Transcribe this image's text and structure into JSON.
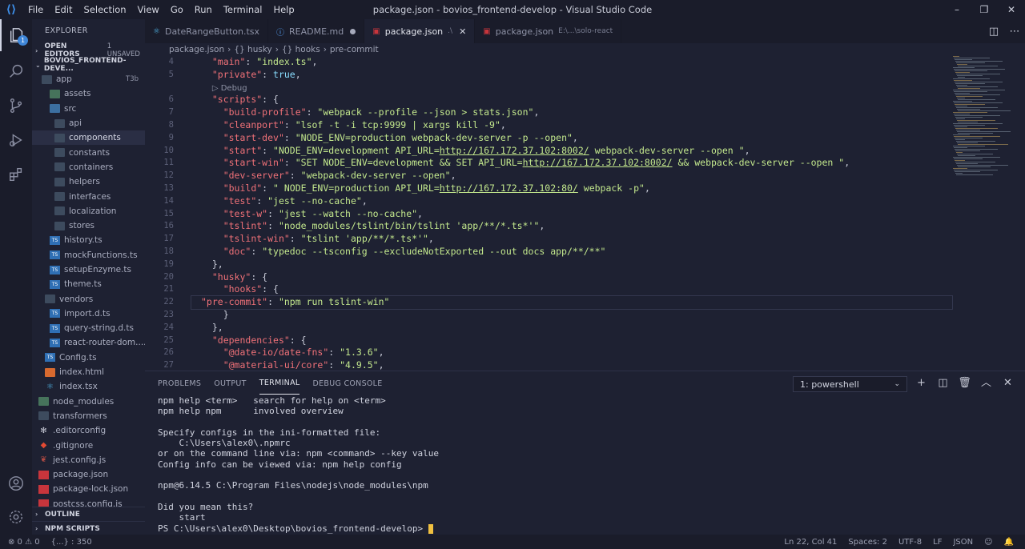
{
  "titlebar": {
    "menu": [
      "File",
      "Edit",
      "Selection",
      "View",
      "Go",
      "Run",
      "Terminal",
      "Help"
    ],
    "window_title": "package.json - bovios_frontend-develop - Visual Studio Code",
    "controls": [
      "–",
      "❐",
      "✕"
    ]
  },
  "activity": {
    "explorer_badge": "1"
  },
  "sidebar": {
    "title": "EXPLORER",
    "open_editors": "OPEN EDITORS",
    "unsaved": "1 UNSAVED",
    "project": "BOVIOS_FRONTEND-DEVE...",
    "tree": [
      {
        "label": "app",
        "icon": "folder",
        "indent": 12,
        "tag": "T3b"
      },
      {
        "label": "assets",
        "icon": "folder green",
        "indent": 22
      },
      {
        "label": "src",
        "icon": "folder blue",
        "indent": 22
      },
      {
        "label": "api",
        "icon": "folder",
        "indent": 28
      },
      {
        "label": "components",
        "icon": "folder",
        "indent": 28,
        "selected": true
      },
      {
        "label": "constants",
        "icon": "folder",
        "indent": 28
      },
      {
        "label": "containers",
        "icon": "folder",
        "indent": 28
      },
      {
        "label": "helpers",
        "icon": "folder",
        "indent": 28
      },
      {
        "label": "interfaces",
        "icon": "folder",
        "indent": 28
      },
      {
        "label": "localization",
        "icon": "folder",
        "indent": 28
      },
      {
        "label": "stores",
        "icon": "folder",
        "indent": 28
      },
      {
        "label": "history.ts",
        "icon": "ts",
        "indent": 22
      },
      {
        "label": "mockFunctions.ts",
        "icon": "ts",
        "indent": 22
      },
      {
        "label": "setupEnzyme.ts",
        "icon": "ts",
        "indent": 22
      },
      {
        "label": "theme.ts",
        "icon": "ts",
        "indent": 22
      },
      {
        "label": "vendors",
        "icon": "folder",
        "indent": 16
      },
      {
        "label": "import.d.ts",
        "icon": "ts",
        "indent": 22
      },
      {
        "label": "query-string.d.ts",
        "icon": "ts",
        "indent": 22
      },
      {
        "label": "react-router-dom....",
        "icon": "ts",
        "indent": 22
      },
      {
        "label": "Config.ts",
        "icon": "ts",
        "indent": 16
      },
      {
        "label": "index.html",
        "icon": "html",
        "indent": 16
      },
      {
        "label": "index.tsx",
        "icon": "tsx",
        "indent": 16
      },
      {
        "label": "node_modules",
        "icon": "folder green",
        "indent": 8
      },
      {
        "label": "transformers",
        "icon": "folder",
        "indent": 8
      },
      {
        "label": ".editorconfig",
        "icon": "cfg",
        "indent": 8
      },
      {
        "label": ".gitignore",
        "icon": "git",
        "indent": 8
      },
      {
        "label": "jest.config.js",
        "icon": "jest",
        "indent": 8
      },
      {
        "label": "package.json",
        "icon": "json",
        "indent": 8
      },
      {
        "label": "package-lock.json",
        "icon": "json",
        "indent": 8
      },
      {
        "label": "postcss.config.js",
        "icon": "json",
        "indent": 8
      }
    ],
    "outline": "OUTLINE",
    "npm_scripts": "NPM SCRIPTS"
  },
  "tabs": [
    {
      "label": "DateRangeButton.tsx",
      "icon": "⚛",
      "color": "#4fb0e0"
    },
    {
      "label": "README.md",
      "icon": "ⓘ",
      "color": "#58a6ff",
      "dot": true
    },
    {
      "label": "package.json",
      "icon": "▣",
      "color": "#c8353c",
      "sub": ".\\",
      "active": true,
      "close": "✕"
    },
    {
      "label": "package.json",
      "icon": "▣",
      "color": "#c8353c",
      "sub": "E:\\...\\solo-react"
    }
  ],
  "breadcrumb": [
    "package.json",
    "›",
    "{} husky",
    "›",
    "{} hooks",
    "›",
    "pre-commit"
  ],
  "code_lines": [
    {
      "n": "4",
      "html": "  <span class='k'>\"main\"</span>: <span class='s'>\"index.ts\"</span>,"
    },
    {
      "n": "5",
      "html": "  <span class='k'>\"private\"</span>: <span class='b'>true</span>,"
    },
    {
      "n": "",
      "html": "  <span class='dbg'>▷ Debug</span>"
    },
    {
      "n": "6",
      "html": "  <span class='k'>\"scripts\"</span>: {"
    },
    {
      "n": "7",
      "html": "    <span class='k'>\"build-profile\"</span>: <span class='s'>\"webpack --profile --json &gt; stats.json\"</span>,"
    },
    {
      "n": "8",
      "html": "    <span class='k'>\"cleanport\"</span>: <span class='s'>\"lsof -t -i tcp:9999 | xargs kill -9\"</span>,"
    },
    {
      "n": "9",
      "html": "    <span class='k'>\"start-dev\"</span>: <span class='s'>\"NODE_ENV=production webpack-dev-server -p --open\"</span>,"
    },
    {
      "n": "10",
      "html": "    <span class='k'>\"start\"</span>: <span class='s'>\"NODE_ENV=development API_URL=</span><span class='u'>http://167.172.37.102:8002/</span><span class='s'> webpack-dev-server --open \"</span>,"
    },
    {
      "n": "11",
      "html": "    <span class='k'>\"start-win\"</span>: <span class='s'>\"SET NODE_ENV=development &amp;&amp; SET API_URL=</span><span class='u'>http://167.172.37.102:8002/</span><span class='s'> &amp;&amp; webpack-dev-server --open \"</span>,"
    },
    {
      "n": "12",
      "html": "    <span class='k'>\"dev-server\"</span>: <span class='s'>\"webpack-dev-server --open\"</span>,"
    },
    {
      "n": "13",
      "html": "    <span class='k'>\"build\"</span>: <span class='s'>\" NODE_ENV=production API_URL=</span><span class='u'>http://167.172.37.102:80/</span><span class='s'> webpack -p\"</span>,"
    },
    {
      "n": "14",
      "html": "    <span class='k'>\"test\"</span>: <span class='s'>\"jest --no-cache\"</span>,"
    },
    {
      "n": "15",
      "html": "    <span class='k'>\"test-w\"</span>: <span class='s'>\"jest --watch --no-cache\"</span>,"
    },
    {
      "n": "16",
      "html": "    <span class='k'>\"tslint\"</span>: <span class='s'>\"node_modules/tslint/bin/tslint 'app/**/*.ts*'\"</span>,"
    },
    {
      "n": "17",
      "html": "    <span class='k'>\"tslint-win\"</span>: <span class='s'>\"tslint 'app/**/*.ts*'\"</span>,"
    },
    {
      "n": "18",
      "html": "    <span class='k'>\"doc\"</span>: <span class='s'>\"typedoc --tsconfig --excludeNotExported --out docs app/**/**\"</span>"
    },
    {
      "n": "19",
      "html": "  },"
    },
    {
      "n": "20",
      "html": "  <span class='k'>\"husky\"</span>: {"
    },
    {
      "n": "21",
      "html": "    <span class='k'>\"hooks\"</span>: {"
    },
    {
      "n": "22",
      "html": "<span class='k'>\"pre-commit\"</span>: <span class='s'>\"npm run tslint-win\"</span>",
      "cur": true
    },
    {
      "n": "23",
      "html": "    }"
    },
    {
      "n": "24",
      "html": "  },"
    },
    {
      "n": "25",
      "html": "  <span class='k'>\"dependencies\"</span>: {"
    },
    {
      "n": "26",
      "html": "    <span class='k'>\"@date-io/date-fns\"</span>: <span class='s'>\"1.3.6\"</span>,"
    },
    {
      "n": "27",
      "html": "    <span class='k'>\"@material-ui/core\"</span>: <span class='s'>\"4.9.5\"</span>,"
    }
  ],
  "panel": {
    "tabs": [
      "PROBLEMS",
      "OUTPUT",
      "TERMINAL",
      "DEBUG CONSOLE"
    ],
    "active_tab": "TERMINAL",
    "shell": "1: powershell",
    "icons": [
      "+",
      "◫",
      "🗑",
      "︿",
      "✕"
    ],
    "terminal": "npm help <term>   search for help on <term>\nnpm help npm      involved overview\n\nSpecify configs in the ini-formatted file:\n    C:\\Users\\alex0\\.npmrc\nor on the command line via: npm <command> --key value\nConfig info can be viewed via: npm help config\n\nnpm@6.14.5 C:\\Program Files\\nodejs\\node_modules\\npm\n\nDid you mean this?\n    start\nPS C:\\Users\\alex0\\Desktop\\bovios_frontend-develop> "
  },
  "status": {
    "left": [
      "⊗ 0  ⚠ 0",
      "{...} : 350"
    ],
    "right": [
      "Ln 22, Col 41",
      "Spaces: 2",
      "UTF-8",
      "LF",
      "JSON",
      "☺",
      "🔔"
    ]
  }
}
